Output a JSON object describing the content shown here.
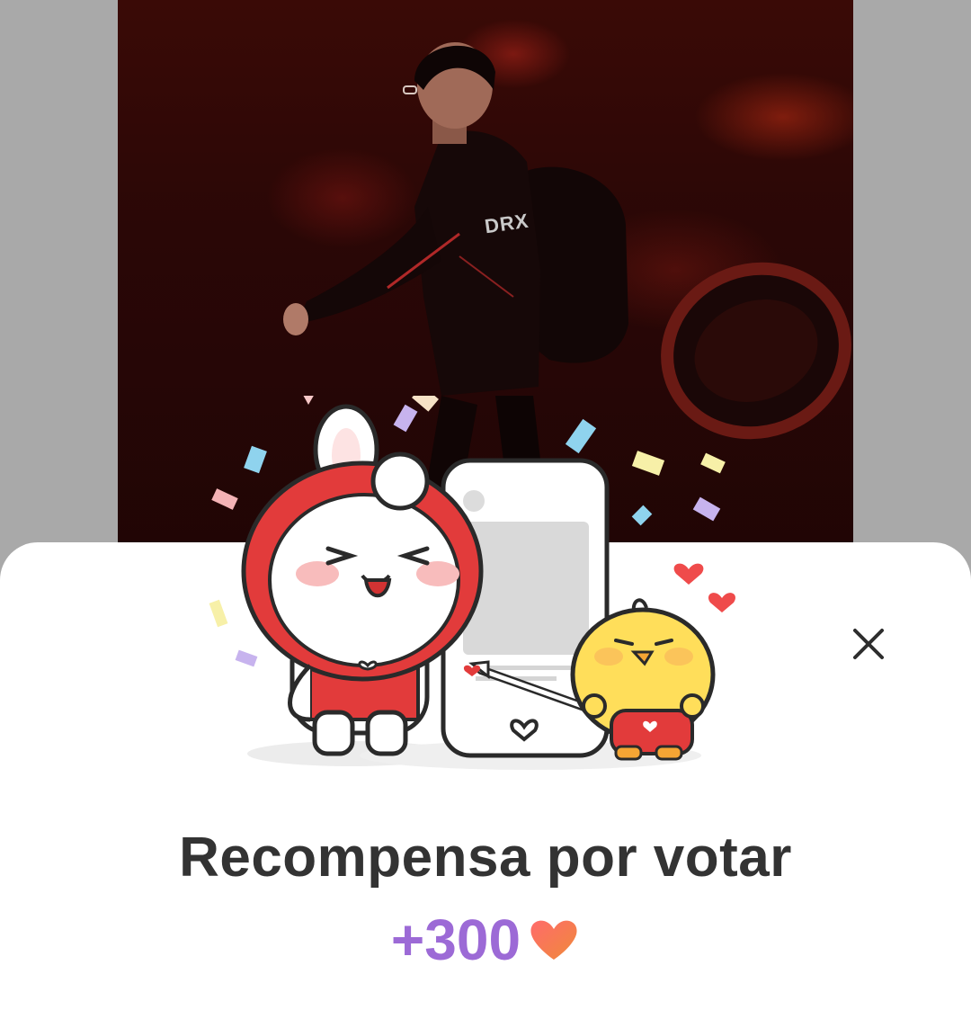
{
  "modal": {
    "title": "Recompensa por votar",
    "reward_amount": "+300",
    "reward_icon": "heart-icon",
    "close_icon": "close-icon"
  },
  "background_photo": {
    "jersey_text": "DRX"
  },
  "colors": {
    "title": "#333333",
    "reward": "#9c6ad6",
    "heart": "#ef4b4b",
    "sheet": "#ffffff",
    "backdrop": "#a9a9a9"
  }
}
